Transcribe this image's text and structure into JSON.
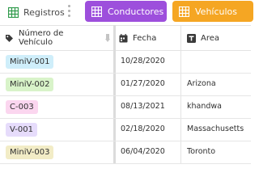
{
  "tabs": {
    "registros": "Registros",
    "conductores": "Conductores",
    "vehiculos": "Vehículos"
  },
  "columns": {
    "numero": "Número de Vehículo",
    "fecha": "Fecha",
    "area": "Area"
  },
  "rows": [
    {
      "numero": "MiniV-001",
      "fecha": "10/28/2020",
      "area": "",
      "tag_color": "#cfeefa"
    },
    {
      "numero": "MiniV-002",
      "fecha": "01/27/2020",
      "area": "Arizona",
      "tag_color": "#d8f3c9"
    },
    {
      "numero": "C-003",
      "fecha": "08/13/2021",
      "area": "khandwa",
      "tag_color": "#fbd6ef"
    },
    {
      "numero": "V-001",
      "fecha": "02/18/2020",
      "area": "Massachusetts",
      "tag_color": "#e6dcfb"
    },
    {
      "numero": "MiniV-003",
      "fecha": "06/04/2020",
      "area": "Toronto",
      "tag_color": "#f2ecc6"
    }
  ],
  "colors": {
    "conductores_tab": "#9d4fdc",
    "vehiculos_tab": "#f5a623",
    "registros_icon": "#2e9a4a"
  },
  "icons": {
    "registros": "grid-icon",
    "conductores": "grid-icon",
    "vehiculos": "grid-icon",
    "numero": "tag-icon",
    "fecha": "calendar-icon",
    "area": "text-icon",
    "sort": "sort-icon"
  }
}
